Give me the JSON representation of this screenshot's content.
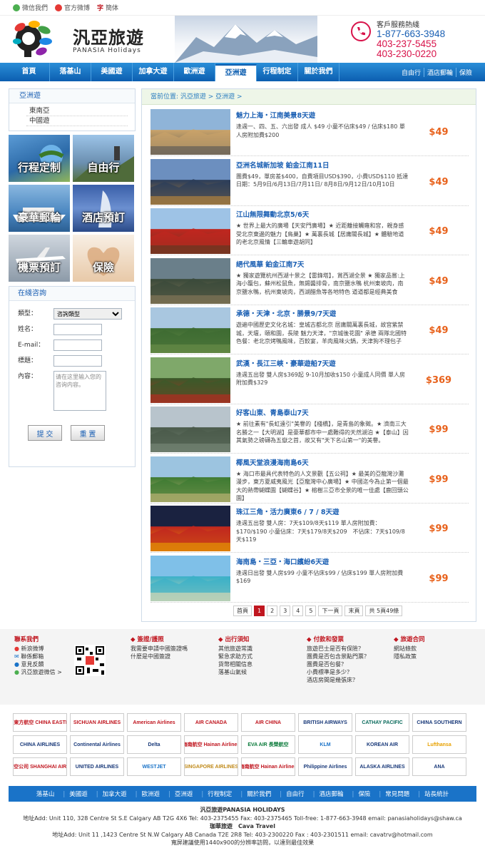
{
  "topbar": {
    "weibo": "微信我們",
    "official": "官方微博",
    "trad": "簡体"
  },
  "logo": {
    "cn": "汎亞旅遊",
    "en": "PANASIA Holidays"
  },
  "contact": {
    "title": "客戶服務熱綫",
    "phones": [
      "1-877-663-3948",
      "403-237-5455",
      "403-230-0220"
    ]
  },
  "nav": {
    "items": [
      "首頁",
      "落基山",
      "美國遊",
      "加拿大遊",
      "歐洲遊",
      "亞洲遊",
      "行程制定",
      "關於我們"
    ],
    "active": 5,
    "right": [
      "自由行",
      "酒店郵輪",
      "保險"
    ]
  },
  "sidebar": {
    "title": "亞洲遊",
    "items": [
      "東南亞",
      "中國遊"
    ],
    "tiles": [
      "行程定制",
      "自由行",
      "豪華郵輪",
      "酒店預訂",
      "機票預訂",
      "保險"
    ]
  },
  "consult": {
    "title": "在綫咨詢",
    "type_label": "類型：",
    "type_value": "咨詢類型",
    "name_label": "姓名：",
    "email_label": "E-mail：",
    "subject_label": "標題：",
    "content_label": "內容：",
    "content_placeholder": "请在这里输入您的咨询内容。",
    "submit": "提 交",
    "reset": "重 置"
  },
  "breadcrumb": "當前位置: 汎亞旅遊 > 亞洲遊 >",
  "tours": [
    {
      "title": "魅力上海・江南美景8天遊",
      "desc": "逢週一、四、五、六出發 成人 $49 小童不佔床$49 / 佔床$180 單人房附加費$200",
      "price": "$49"
    },
    {
      "title": "亞洲名城新加坡 鉑金江南11日",
      "desc": "團費$49，單房差$400，自費項目USD$390，小費USD$110 抵達日期：5月9日/6月13日/7月11日/ 8月8日/9月12日/10月10日",
      "price": "$49"
    },
    {
      "title": "江山無限舞動北京5/6天",
      "desc": "★ 世界上最大的廣場【天安門廣場】★ 近距離接觸雍和宮，親身感受北京東邊的魅力【鳥巢】★ 萬裏長城【居庸關長城】★ 體驗地道的老北京風情【三輪車遊胡同】",
      "price": "$49"
    },
    {
      "title": "絕代風華 鉑金江南7天",
      "desc": "★ 獨家遊覽杭州西湖十景之【雷鋒塔】，賞西湖全景 ★ 獨家品嘗:上海小籠包，蘇州松鼠魚，無錫醬排骨，南京鹽水鴨 杭州東坡肉，南京鹽水鴨，杭州東坡肉，西湖醋魚等各地特色 道道都是經典美食",
      "price": "$49"
    },
    {
      "title": "承德・天津・北京・勝景9/7天遊",
      "desc": "遊遍中國歷史文化名城：皇城古都北京 居庸關萬裏長城，故宮紫禁城，天壇，頤和園，長陵 魅力天津，\"京城後花園\" 承德 兩隊北國特色餐：老北京烤鴨風味，百餃宴，羊肉風味火鍋，天津狗不理包子",
      "price": "$49"
    },
    {
      "title": "武漢・長江三峽・豪華遊船7天遊",
      "desc": "逢週五出發 雙人房$369起 9-10月加收$150 小童成人同價 單人房附加費$329",
      "price": "$369"
    },
    {
      "title": "好客山東、青島泰山7天",
      "desc": "★ 前往素有\"長虹遠引\"美譽的【棧橋】，是青島的象徵。★ 濟南三大名勝之一【大明湖】是豪華都市中一處難得的天然湖泊 ★【泰山】因其氣勢之磅礴為五嶽之首，故又有\"天下名山第一\"的美譽。",
      "price": "$99"
    },
    {
      "title": "椰風天堂浪漫海南島6天",
      "desc": "★ 海口市最具代表特色的人文景觀【五公祠】★ 最美的亞龍灣沙灘漫步，東方夏威夷風光【亞龍灣中心廣場】★ 中國迄今為止第一個最大的熱帶蝴蝶園【蝴蝶谷】★ 榕樹三亞市全景的唯一佳處【鹿回頭公園】",
      "price": "$99"
    },
    {
      "title": "珠江三角・活力廣東6 / 7 / 8天遊",
      "desc": "逢週五出發 雙人房：7天$109/8天$119 單人房附加費：$170/$190 小童佔床：7天$179/8天$209　不佔床：7天$109/8天$119",
      "price": "$99"
    },
    {
      "title": "海南島・三亞・海口繽紛6天遊",
      "desc": "逢週日出發 雙人房$99 小童不佔床$99 / 佔床$199 單人房附加費$169",
      "price": "$99"
    }
  ],
  "pager": {
    "first": "首頁",
    "pages": [
      "1",
      "2",
      "3",
      "4",
      "5"
    ],
    "current": "1",
    "next": "下一頁",
    "last": "末頁",
    "total": "共 5頁49條"
  },
  "footer": {
    "contact": {
      "title": "聯系我們",
      "items": [
        "新浪微博",
        "聯係郵箱",
        "意見反饋",
        "汎亞旅遊微信 >"
      ]
    },
    "cols": [
      {
        "title": "簽證/護照",
        "items": [
          "我需要申請中國簽證嗎",
          "什麽是中國簽證"
        ]
      },
      {
        "title": "出行須知",
        "items": [
          "其他旅遊常識",
          "緊急求助方式",
          "貨幣相關信息",
          "落基山氣候"
        ]
      },
      {
        "title": "付款和發票",
        "items": [
          "旅遊巴士是否有保險？",
          "團費是否包含景點門票？",
          "團費是否包餐？",
          "小費標準是多少？",
          "酒店房間是幾張床？"
        ]
      },
      {
        "title": "旅遊合同",
        "items": [
          "網站條款",
          "隱私政策"
        ]
      }
    ]
  },
  "airlines": [
    {
      "name": "中國東方航空 CHINA EASTERN",
      "color": "#c0161f"
    },
    {
      "name": "SICHUAN AIRLINES",
      "color": "#c0161f"
    },
    {
      "name": "American Airlines",
      "color": "#c0161f"
    },
    {
      "name": "AIR CANADA",
      "color": "#c0161f"
    },
    {
      "name": "AIR CHINA",
      "color": "#c0161f"
    },
    {
      "name": "BRITISH AIRWAYS",
      "color": "#1a3a7a"
    },
    {
      "name": "CATHAY PACIFIC",
      "color": "#0a6b5c"
    },
    {
      "name": "CHINA SOUTHERN",
      "color": "#1a3a7a"
    },
    {
      "name": "CHINA AIRLINES",
      "color": "#1a3a7a"
    },
    {
      "name": "Continental Airlines",
      "color": "#1a3a7a"
    },
    {
      "name": "Delta",
      "color": "#1a3a7a"
    },
    {
      "name": "海南航空 Hainan Airlines",
      "color": "#c0161f"
    },
    {
      "name": "EVA AIR 長榮航空",
      "color": "#0a7a3a"
    },
    {
      "name": "KLM",
      "color": "#1a73c8"
    },
    {
      "name": "KOREAN AIR",
      "color": "#1a3a7a"
    },
    {
      "name": "Lufthansa",
      "color": "#e8a100"
    },
    {
      "name": "上海航空公司 SHANGHAI AIRLINES",
      "color": "#c0161f"
    },
    {
      "name": "UNITED AIRLINES",
      "color": "#1a3a7a"
    },
    {
      "name": "WESTJET",
      "color": "#1a73c8"
    },
    {
      "name": "SINGAPORE AIRLINES",
      "color": "#c08a1a"
    },
    {
      "name": "海南航空 Hainan Airlines",
      "color": "#c0161f"
    },
    {
      "name": "Philippine Airlines",
      "color": "#1a3a7a"
    },
    {
      "name": "ALASKA AIRLINES",
      "color": "#1a3a7a"
    },
    {
      "name": "ANA",
      "color": "#1a3a7a"
    }
  ],
  "botnav": [
    "落基山",
    "美國遊",
    "加拿大遊",
    "歐洲遊",
    "亞洲遊",
    "行程制定",
    "關於我們",
    "自由行",
    "酒店郵輪",
    "保險",
    "常見問題",
    "站長統計"
  ],
  "address": {
    "company1": "汎亞旅遊PANASIA HOLIDAYS",
    "line1": "地址Add: Unit 110, 328 Centre St S.E Calgary AB T2G 4X6 Tel: 403-2375455 Fax: 403-2375465 Toll-free: 1-877-663-3948 email: panasiaholidays@shaw.ca",
    "company2": "珈華旅遊　Cava Travel",
    "line2": "地址Add: Unit 11 ,1423 Centre St N.W Calgary AB Canada T2E 2R8 Tel: 403-2300220 Fax : 403-2301511 email: cavatrv@hotmail.com",
    "line3": "寬屏建議使用1440x900的分辨率訪問，以達到最佳效果"
  },
  "colors": {
    "brand_blue": "#0c5eb0",
    "price_orange": "#e8621c",
    "accent_red": "#c0161f"
  }
}
